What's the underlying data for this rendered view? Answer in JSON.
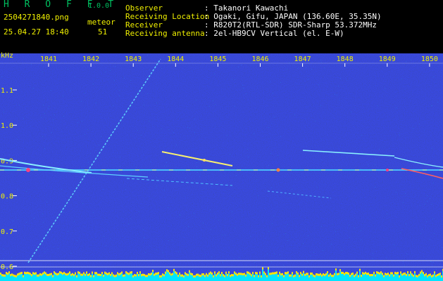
{
  "header": {
    "app_name": "H R O F F T",
    "version": "1.0.0",
    "filename": "2504271840.png",
    "datetime": "25.04.27 18:40",
    "meteor_label": "meteor",
    "meteor_count": "51",
    "info": [
      {
        "label": "Observer",
        "value": ": Takanori Kawachi"
      },
      {
        "label": "Receiving Location",
        "value": ": Ogaki, Gifu, JAPAN (136.60E, 35.35N)"
      },
      {
        "label": "Receiver",
        "value": ": R820T2(RTL-SDR) SDR-Sharp 53.372MHz"
      },
      {
        "label": "Receiving antenna",
        "value": ": 2el-HB9CV Vertical (el. E-W)"
      }
    ]
  },
  "axes": {
    "y_unit": "kHz",
    "x_ticks": [
      "1841",
      "1842",
      "1843",
      "1844",
      "1845",
      "1846",
      "1847",
      "1848",
      "1849",
      "1850"
    ],
    "y_ticks": [
      "1.1",
      "1.0",
      "0.9",
      "0.8",
      "0.7",
      "0.6"
    ]
  },
  "colors": {
    "background_low": "#0a0a6e",
    "tick_text": "#f0f000",
    "header_text": "#ffffff",
    "logo": "#00c060",
    "level_bars": "#00e5ff",
    "level_peaks": "#ffe000"
  }
}
